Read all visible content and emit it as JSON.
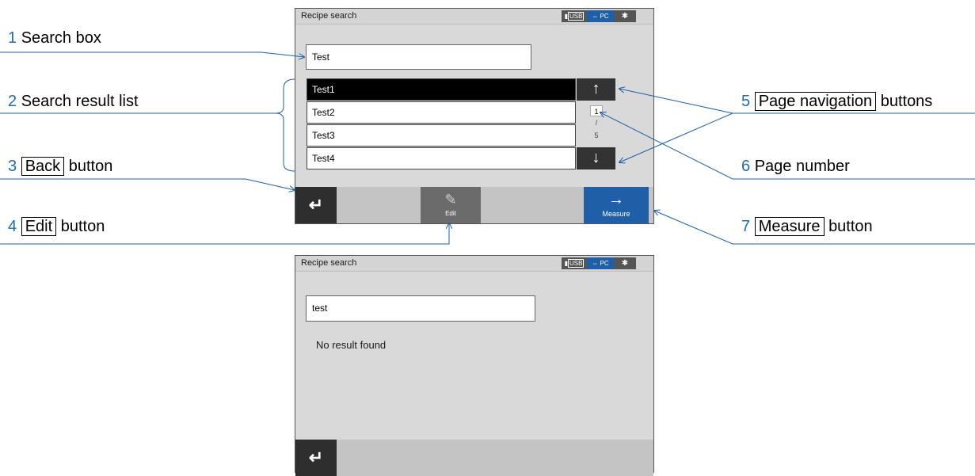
{
  "screen1": {
    "title": "Recipe search",
    "status": {
      "usb": "USB",
      "pc": "PC",
      "bluetooth_icon": "bluetooth-icon"
    },
    "search_value": "Test",
    "results": [
      "Test1",
      "Test2",
      "Test3",
      "Test4"
    ],
    "page_current": "1",
    "page_separator": "/",
    "page_total": "5",
    "edit_label": "Edit",
    "measure_label": "Measure"
  },
  "screen2": {
    "title": "Recipe search",
    "status": {
      "usb": "USB",
      "pc": "PC",
      "bluetooth_icon": "bluetooth-icon"
    },
    "search_value": "test",
    "no_result": "No result found"
  },
  "callouts": [
    {
      "num": "1",
      "text": "Search box"
    },
    {
      "num": "2",
      "text": "Search result list"
    },
    {
      "num": "3",
      "boxed": "Back",
      "text": "button"
    },
    {
      "num": "4",
      "boxed": "Edit",
      "text": "button"
    },
    {
      "num": "5",
      "boxed": "Page navigation",
      "text": "buttons"
    },
    {
      "num": "6",
      "text": "Page number"
    },
    {
      "num": "7",
      "boxed": "Measure",
      "text": "button"
    }
  ],
  "colors": {
    "accent_blue": "#1e5fa8",
    "callout_number": "#1e6bb8",
    "leader_line": "#1e5fa8"
  }
}
